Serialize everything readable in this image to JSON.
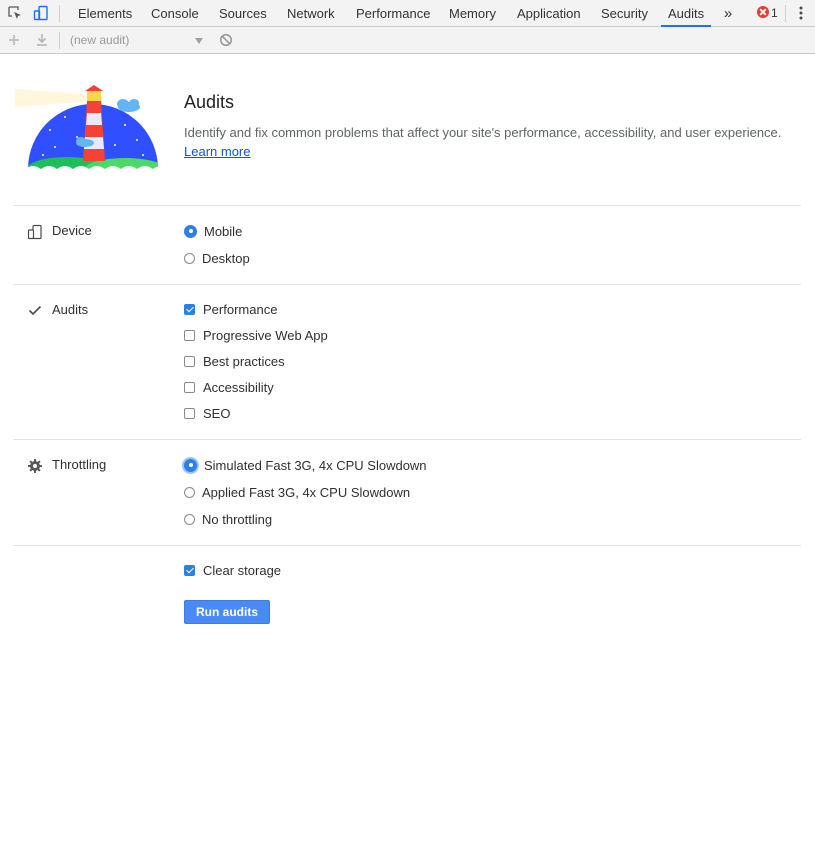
{
  "tabbar": {
    "tabs": [
      {
        "label": "Elements"
      },
      {
        "label": "Console"
      },
      {
        "label": "Sources"
      },
      {
        "label": "Network"
      },
      {
        "label": "Performance"
      },
      {
        "label": "Memory"
      },
      {
        "label": "Application"
      },
      {
        "label": "Security"
      },
      {
        "label": "Audits",
        "active": true
      }
    ],
    "overflow_glyph": "»",
    "error_count": "1",
    "accent_color": "#1a73e8"
  },
  "toolbar": {
    "audit_select_value": "(new audit)"
  },
  "header": {
    "title": "Audits",
    "description": "Identify and fix common problems that affect your site's performance, accessibility, and user experience.",
    "learn_more": "Learn more"
  },
  "sections": {
    "device": {
      "label": "Device",
      "icon": "device-icon",
      "options": [
        {
          "label": "Mobile",
          "selected": true
        },
        {
          "label": "Desktop",
          "selected": false
        }
      ]
    },
    "audits": {
      "label": "Audits",
      "icon": "checkmark-icon",
      "options": [
        {
          "label": "Performance",
          "checked": true
        },
        {
          "label": "Progressive Web App",
          "checked": false
        },
        {
          "label": "Best practices",
          "checked": false
        },
        {
          "label": "Accessibility",
          "checked": false
        },
        {
          "label": "SEO",
          "checked": false
        }
      ]
    },
    "throttling": {
      "label": "Throttling",
      "icon": "gear-icon",
      "options": [
        {
          "label": "Simulated Fast 3G, 4x CPU Slowdown",
          "selected": true
        },
        {
          "label": "Applied Fast 3G, 4x CPU Slowdown",
          "selected": false
        },
        {
          "label": "No throttling",
          "selected": false
        }
      ]
    }
  },
  "clear_storage": {
    "label": "Clear storage",
    "checked": true
  },
  "run_button": {
    "label": "Run audits",
    "color": "#4a8af4"
  }
}
